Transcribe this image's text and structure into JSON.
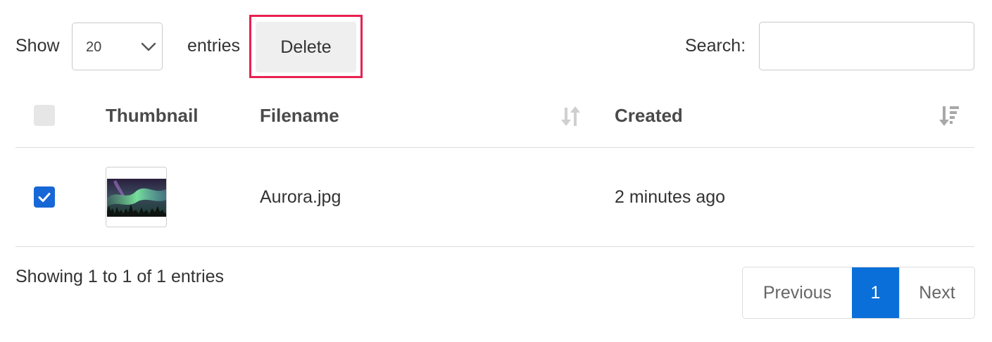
{
  "toolbar": {
    "show_label": "Show",
    "page_length": "20",
    "entries_label": "entries",
    "delete_label": "Delete",
    "search_label": "Search:",
    "search_value": ""
  },
  "table": {
    "columns": [
      "Thumbnail",
      "Filename",
      "Created"
    ],
    "rows": [
      {
        "checked": true,
        "thumbnail": "aurora-image",
        "filename": "Aurora.jpg",
        "created": "2 minutes ago"
      }
    ]
  },
  "footer": {
    "info": "Showing 1 to 1 of 1 entries",
    "previous_label": "Previous",
    "current_page": "1",
    "next_label": "Next"
  },
  "colors": {
    "accent": "#0a6fd9",
    "checkbox_checked": "#1767d6",
    "highlight_outline": "#e8214f",
    "delete_bg": "#efefef"
  },
  "icons": [
    "chevron-down-icon",
    "sort-both-icon",
    "sort-desc-icon",
    "check-icon"
  ]
}
